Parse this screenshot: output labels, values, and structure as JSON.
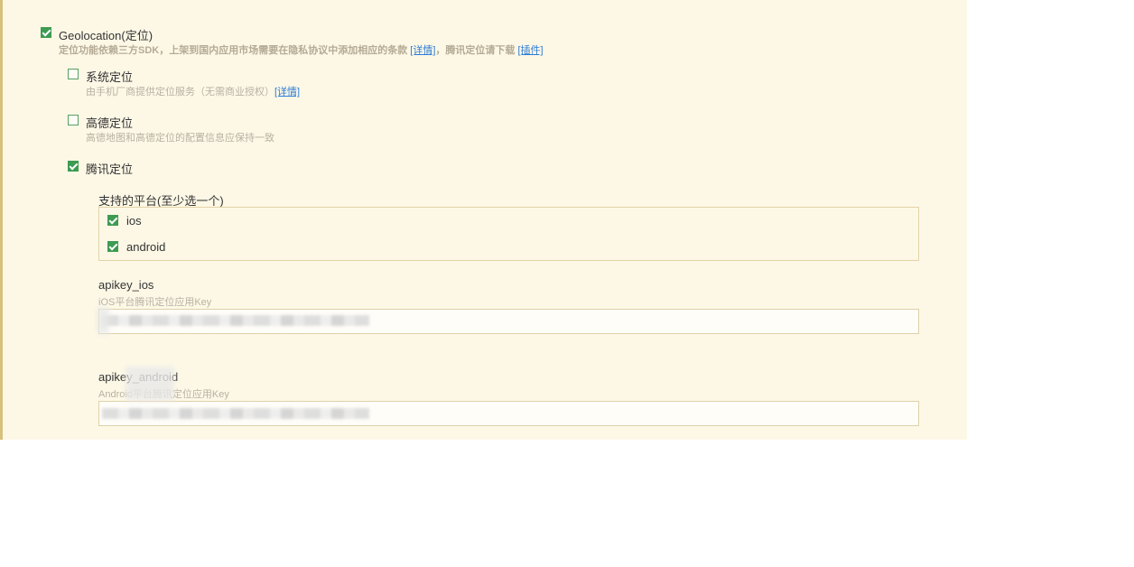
{
  "geolocation": {
    "label": "Geolocation(定位)",
    "checked": true,
    "desc_prefix": "定位功能依赖三方SDK，上架到国内应用市场需要在隐私协议中添加相应的条款",
    "detail_link": "[详情]",
    "desc_middle": "，腾讯定位请下载",
    "plugin_link": "[插件]"
  },
  "providers": [
    {
      "label": "系统定位",
      "checked": false,
      "desc": "由手机厂商提供定位服务（无需商业授权）",
      "link": "[详情]"
    },
    {
      "label": "高德定位",
      "checked": false,
      "desc": "高德地图和高德定位的配置信息应保持一致"
    },
    {
      "label": "腾讯定位",
      "checked": true
    }
  ],
  "platforms": {
    "title": "支持的平台(至少选一个)",
    "items": [
      {
        "label": "ios",
        "checked": true
      },
      {
        "label": "android",
        "checked": true
      }
    ]
  },
  "apikey_ios": {
    "label": "apikey_ios",
    "desc": "iOS平台腾讯定位应用Key",
    "value": ""
  },
  "apikey_android": {
    "label": "apikey_android",
    "desc": "Android平台腾讯定位应用Key",
    "value": ""
  },
  "colors": {
    "panel_bg": "#fdf8e6",
    "accent_green": "#3e9b52",
    "link_blue": "#2b7bd6",
    "border_left": "#d7c07c"
  },
  "icons": [
    "checkbox-checked-icon",
    "checkbox-unchecked-icon"
  ]
}
